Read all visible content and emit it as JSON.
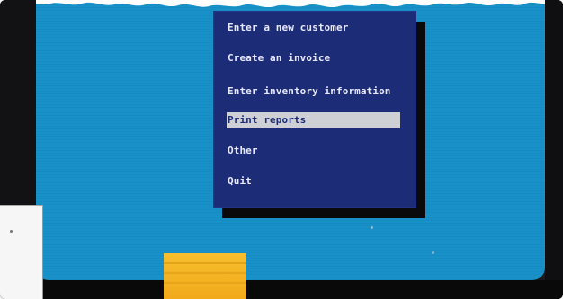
{
  "window": {
    "title": ""
  },
  "menu": {
    "items": [
      {
        "label": "Enter a new customer",
        "selected": false
      },
      {
        "label": "Create an invoice",
        "selected": false
      },
      {
        "label": "Enter inventory information",
        "selected": false
      },
      {
        "label": "Print reports",
        "selected": true
      },
      {
        "label": "Other",
        "selected": false
      },
      {
        "label": "Quit",
        "selected": false
      }
    ]
  },
  "theme": {
    "screen_color": "#1891c9",
    "menu_color": "#1d2c77",
    "menu_text_color": "#e8e8ff",
    "selection_color": "#cfcfd6",
    "accent_yellow": "#f5b82a",
    "frame_color": "#1a1a1c"
  }
}
